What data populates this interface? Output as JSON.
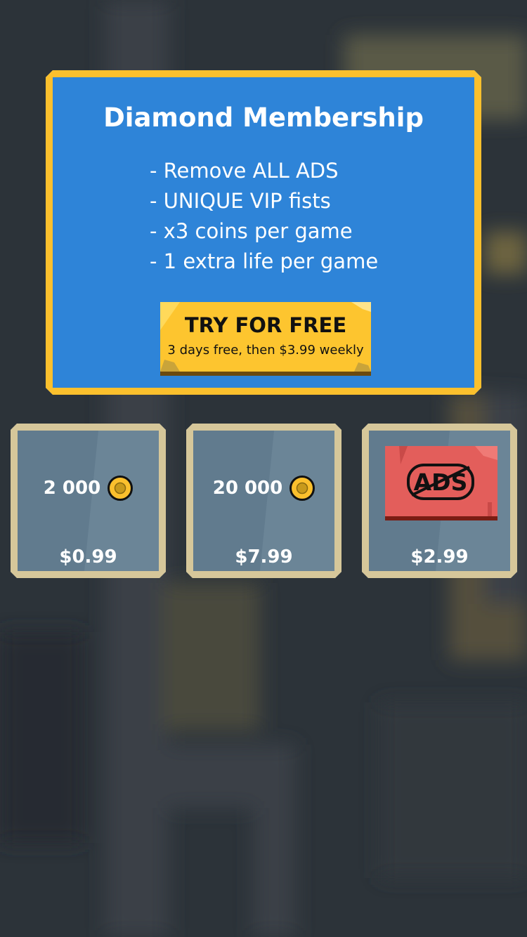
{
  "membership": {
    "title": "Diamond Membership",
    "features": [
      "- Remove ALL  ADS",
      "- UNIQUE VIP fists",
      "- x3 coins per game",
      "- 1 extra life per game"
    ],
    "cta": {
      "label": "TRY FOR FREE",
      "subtext": "3 days free, then $3.99 weekly"
    }
  },
  "shop": {
    "items": [
      {
        "amount": "2 000",
        "icon": "coin-icon",
        "price": "$0.99"
      },
      {
        "amount": "20 000",
        "icon": "coin-icon",
        "price": "$7.99"
      },
      {
        "label": "ADS",
        "icon": "no-ads-icon",
        "price": "$2.99"
      }
    ]
  },
  "colors": {
    "panel_blue": "#2e84d8",
    "gold_border": "#fbc02d",
    "button_yellow": "#fdc52f",
    "tile_fill": "#617b8e",
    "tile_border": "#d6c79a",
    "ads_red": "#e35e5b"
  }
}
